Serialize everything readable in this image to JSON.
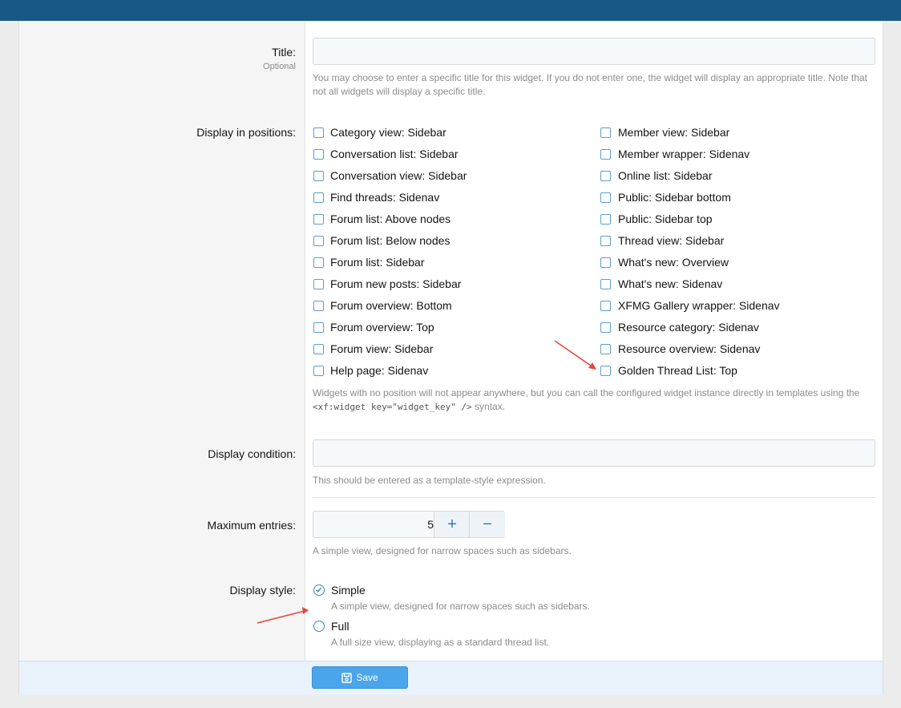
{
  "title_field": {
    "label": "Title:",
    "hint": "Optional",
    "value": "",
    "explain": "You may choose to enter a specific title for this widget. If you do not enter one, the widget will display an appropriate title. Note that not all widgets will display a specific title."
  },
  "positions": {
    "label": "Display in positions:",
    "left_column": [
      "Category view: Sidebar",
      "Conversation list: Sidebar",
      "Conversation view: Sidebar",
      "Find threads: Sidenav",
      "Forum list: Above nodes",
      "Forum list: Below nodes",
      "Forum list: Sidebar",
      "Forum new posts: Sidebar",
      "Forum overview: Bottom",
      "Forum overview: Top",
      "Forum view: Sidebar",
      "Help page: Sidenav"
    ],
    "right_column": [
      "Member view: Sidebar",
      "Member wrapper: Sidenav",
      "Online list: Sidebar",
      "Public: Sidebar bottom",
      "Public: Sidebar top",
      "Thread view: Sidebar",
      "What's new: Overview",
      "What's new: Sidenav",
      "XFMG Gallery wrapper: Sidenav",
      "Resource category: Sidenav",
      "Resource overview: Sidenav",
      "Golden Thread List: Top"
    ],
    "explain_before": "Widgets with no position will not appear anywhere, but you can call the configured widget instance directly in templates using the ",
    "explain_code": "<xf:widget key=\"widget_key\" />",
    "explain_after": " syntax."
  },
  "condition_field": {
    "label": "Display condition:",
    "value": "",
    "explain": "This should be entered as a template-style expression."
  },
  "max_entries": {
    "label": "Maximum entries:",
    "value": "5",
    "plus": "+",
    "minus": "−",
    "explain": "A simple view, designed for narrow spaces such as sidebars."
  },
  "display_style": {
    "label": "Display style:",
    "options": [
      {
        "label": "Simple",
        "hint": "A simple view, designed for narrow spaces such as sidebars.",
        "selected": true
      },
      {
        "label": "Full",
        "hint": "A full size view, displaying as a standard thread list.",
        "selected": false
      }
    ]
  },
  "footer": {
    "save_label": "Save"
  },
  "colors": {
    "topbar": "#185886",
    "accent": "#4aa5ea",
    "arrow": "#e8453c"
  }
}
